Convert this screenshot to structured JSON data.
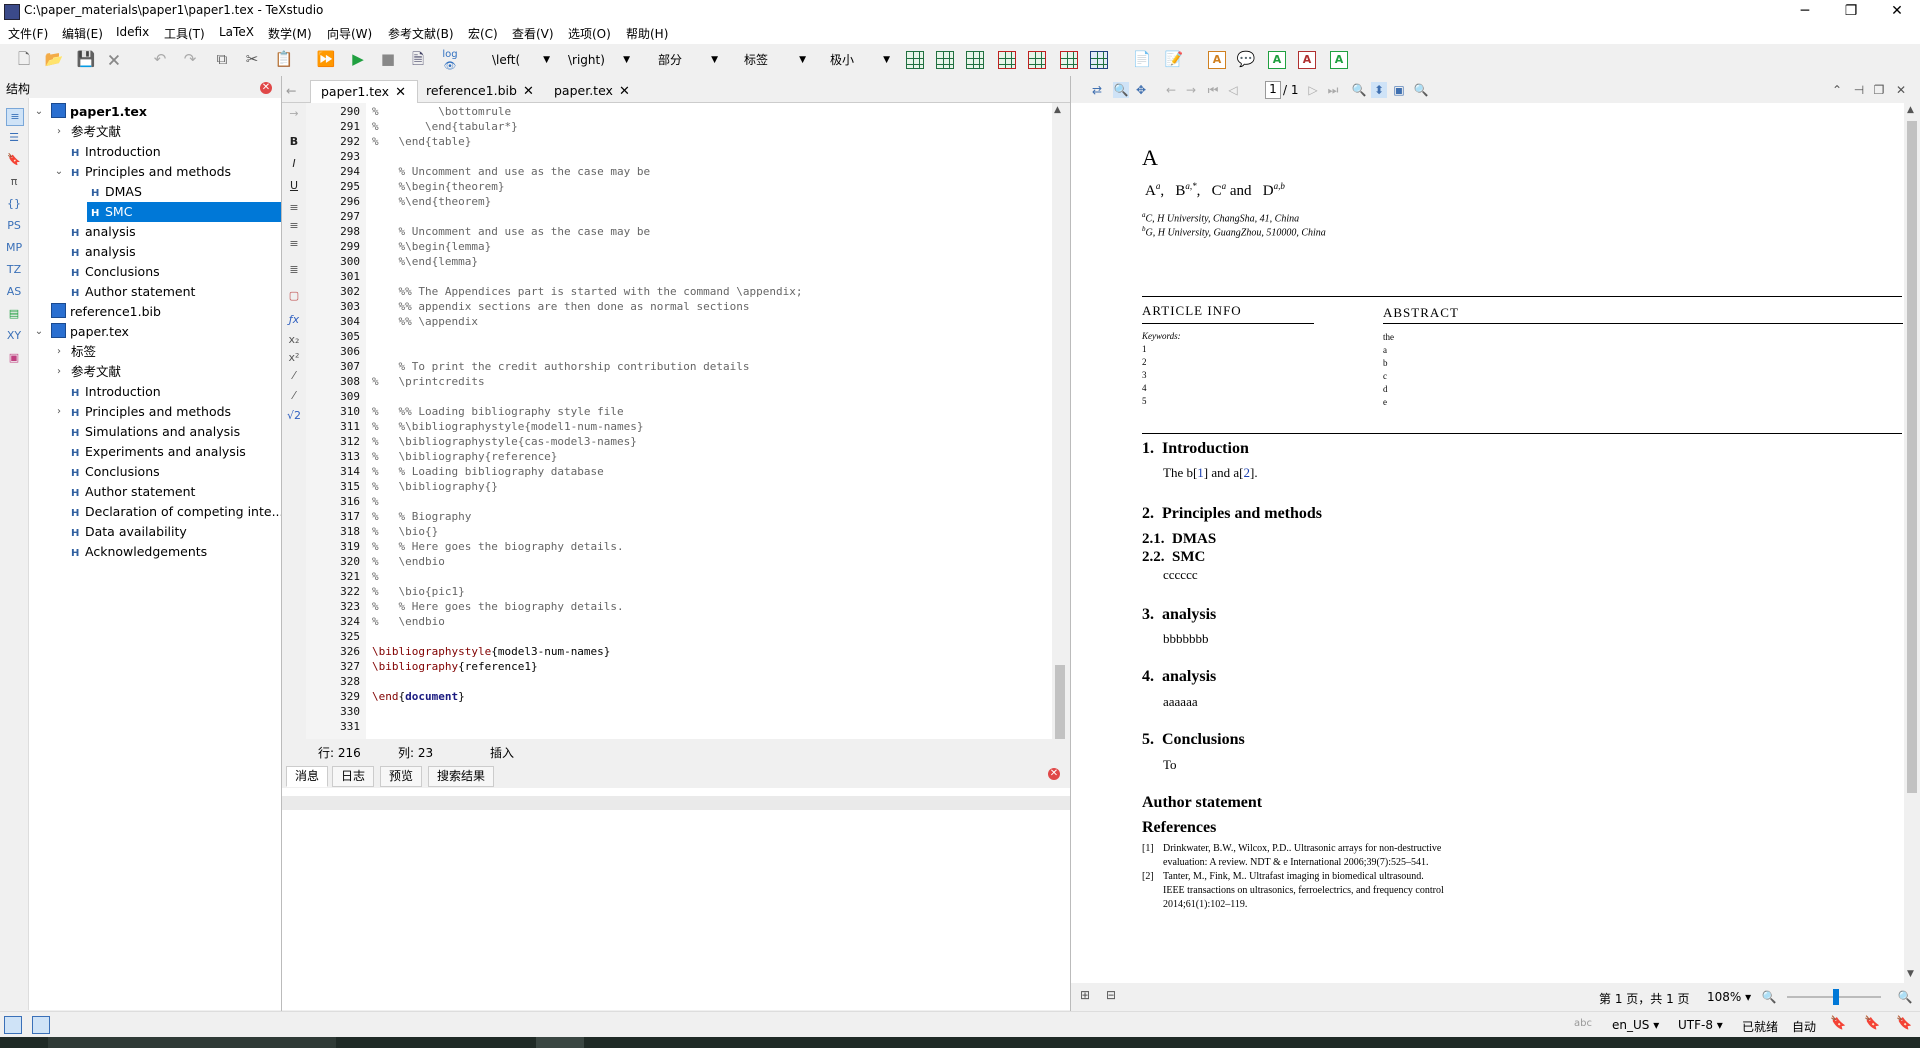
{
  "window": {
    "title": "C:\\paper_materials\\paper1\\paper1.tex - TeXstudio",
    "minimize": "─",
    "maximize": "❐",
    "close": "✕"
  },
  "menu": [
    "文件(F)",
    "编辑(E)",
    "Idefix",
    "工具(T)",
    "LaTeX",
    "数学(M)",
    "向导(W)",
    "参考文献(B)",
    "宏(C)",
    "查看(V)",
    "选项(O)",
    "帮助(H)"
  ],
  "toolbar": {
    "left_combo": "\\left(",
    "right_combo": "\\right)",
    "section_combo": "部分",
    "label_combo": "标签",
    "size_combo": "极小",
    "log_label": "log"
  },
  "structure": {
    "title": "结构",
    "items": [
      {
        "text": "paper1.tex",
        "kind": "file",
        "level": 0,
        "expanded": true,
        "bold": true
      },
      {
        "text": "参考文献",
        "kind": "group",
        "level": 1,
        "expanded": false
      },
      {
        "text": "Introduction",
        "kind": "h",
        "level": 1
      },
      {
        "text": "Principles and methods",
        "kind": "h",
        "level": 1,
        "expanded": true
      },
      {
        "text": "DMAS",
        "kind": "h",
        "level": 2
      },
      {
        "text": "SMC",
        "kind": "h",
        "level": 2,
        "selected": true
      },
      {
        "text": "analysis",
        "kind": "h",
        "level": 1
      },
      {
        "text": "analysis",
        "kind": "h",
        "level": 1
      },
      {
        "text": "Conclusions",
        "kind": "h",
        "level": 1
      },
      {
        "text": "Author statement",
        "kind": "h",
        "level": 1
      },
      {
        "text": "reference1.bib",
        "kind": "file",
        "level": 0
      },
      {
        "text": "paper.tex",
        "kind": "file",
        "level": 0,
        "expanded": true
      },
      {
        "text": "标签",
        "kind": "group",
        "level": 1,
        "expanded": false
      },
      {
        "text": "参考文献",
        "kind": "group",
        "level": 1,
        "expanded": false
      },
      {
        "text": "Introduction",
        "kind": "h",
        "level": 1
      },
      {
        "text": "Principles and methods",
        "kind": "h",
        "level": 1,
        "expanded": false
      },
      {
        "text": "Simulations and analysis",
        "kind": "h",
        "level": 1
      },
      {
        "text": "Experiments and analysis",
        "kind": "h",
        "level": 1
      },
      {
        "text": "Conclusions",
        "kind": "h",
        "level": 1
      },
      {
        "text": "Author statement",
        "kind": "h",
        "level": 1
      },
      {
        "text": "Declaration of competing inte...",
        "kind": "h",
        "level": 1
      },
      {
        "text": "Data availability",
        "kind": "h",
        "level": 1
      },
      {
        "text": "Acknowledgements",
        "kind": "h",
        "level": 1
      }
    ]
  },
  "left_strip_icons": [
    "PS",
    "MP",
    "TZ",
    "AS",
    "XY"
  ],
  "editor": {
    "tabs": [
      {
        "label": "paper1.tex",
        "active": true
      },
      {
        "label": "reference1.bib",
        "active": false
      },
      {
        "label": "paper.tex",
        "active": false
      }
    ],
    "lines": [
      {
        "n": "290",
        "text": "%         \\bottomrule"
      },
      {
        "n": "291",
        "text": "%       \\end{tabular*}"
      },
      {
        "n": "292",
        "text": "%   \\end{table}"
      },
      {
        "n": "293",
        "text": ""
      },
      {
        "n": "294",
        "text": "    % Uncomment and use as the case may be"
      },
      {
        "n": "295",
        "text": "    %\\begin{theorem}"
      },
      {
        "n": "296",
        "text": "    %\\end{theorem}"
      },
      {
        "n": "297",
        "text": ""
      },
      {
        "n": "298",
        "text": "    % Uncomment and use as the case may be"
      },
      {
        "n": "299",
        "text": "    %\\begin{lemma}"
      },
      {
        "n": "300",
        "text": "    %\\end{lemma}"
      },
      {
        "n": "301",
        "text": ""
      },
      {
        "n": "302",
        "text": "    %% The Appendices part is started with the command \\appendix;"
      },
      {
        "n": "303",
        "text": "    %% appendix sections are then done as normal sections"
      },
      {
        "n": "304",
        "text": "    %% \\appendix"
      },
      {
        "n": "305",
        "text": ""
      },
      {
        "n": "306",
        "text": ""
      },
      {
        "n": "307",
        "text": "    % To print the credit authorship contribution details"
      },
      {
        "n": "308",
        "text": "%   \\printcredits"
      },
      {
        "n": "309",
        "text": ""
      },
      {
        "n": "310",
        "text": "%   %% Loading bibliography style file"
      },
      {
        "n": "311",
        "text": "%   %\\bibliographystyle{model1-num-names}"
      },
      {
        "n": "312",
        "text": "%   \\bibliographystyle{cas-model3-names}"
      },
      {
        "n": "313",
        "text": "%   \\bibliography{reference}"
      },
      {
        "n": "314",
        "text": "%   % Loading bibliography database"
      },
      {
        "n": "315",
        "text": "%   \\bibliography{}"
      },
      {
        "n": "316",
        "text": "%"
      },
      {
        "n": "317",
        "text": "%   % Biography"
      },
      {
        "n": "318",
        "text": "%   \\bio{}"
      },
      {
        "n": "319",
        "text": "%   % Here goes the biography details."
      },
      {
        "n": "320",
        "text": "%   \\endbio"
      },
      {
        "n": "321",
        "text": "%"
      },
      {
        "n": "322",
        "text": "%   \\bio{pic1}"
      },
      {
        "n": "323",
        "text": "%   % Here goes the biography details."
      },
      {
        "n": "324",
        "text": "%   \\endbio"
      },
      {
        "n": "325",
        "text": ""
      },
      {
        "n": "326",
        "text": "\\bibliographystyle{model3-num-names}",
        "cmd": true
      },
      {
        "n": "327",
        "text": "\\bibliography{reference1}",
        "cmd": true
      },
      {
        "n": "328",
        "text": ""
      },
      {
        "n": "329",
        "text": "\\end{document}",
        "cmd": true
      },
      {
        "n": "330",
        "text": ""
      },
      {
        "n": "331",
        "text": ""
      }
    ],
    "status": {
      "row": "行:  216",
      "col": "列:  23",
      "mode": "插入"
    }
  },
  "messages": {
    "tabs": [
      "消息",
      "日志",
      "预览",
      "搜索结果"
    ]
  },
  "viewer": {
    "page_field": "1",
    "page_total": "/ 1",
    "page_status": "第 1 页，共 1 页",
    "zoom": "108%",
    "pdf": {
      "title": "A",
      "authors": [
        "A",
        "a",
        "B",
        "a,*",
        "C",
        "a",
        "D",
        "a,b"
      ],
      "affil_a": "C, H University, ChangSha, 41, China",
      "affil_b": "G, H University, GuangZhou, 510000, China",
      "article_info": "ARTICLE INFO",
      "abstract": "ABSTRACT",
      "keywords_label": "Keywords:",
      "keywords": [
        "1",
        "2",
        "3",
        "4",
        "5"
      ],
      "abstract_lines": [
        "the",
        "a",
        "b",
        "c",
        "d",
        "e"
      ],
      "s1_num": "1.",
      "s1": "Introduction",
      "s1_text_pre": "The b[",
      "cite1": "1",
      "s1_text_mid": "] and a[",
      "cite2": "2",
      "s1_text_post": "].",
      "s2_num": "2.",
      "s2": "Principles and methods",
      "s21_num": "2.1.",
      "s21": "DMAS",
      "s22_num": "2.2.",
      "s22": "SMC",
      "s22_text": "cccccc",
      "s3_num": "3.",
      "s3": "analysis",
      "s3_text": "bbbbbbb",
      "s4_num": "4.",
      "s4": "analysis",
      "s4_text": "aaaaaa",
      "s5_num": "5.",
      "s5": "Conclusions",
      "s5_text": "To",
      "author_statement": "Author statement",
      "references": "References",
      "ref1_num": "[1]",
      "ref1_l1": "Drinkwater,  B.W., Wilcox,  P.D..  Ultrasonic arrays for non-destructive",
      "ref1_l2": "evaluation: A review.  NDT & e International 2006;39(7):525–541.",
      "ref2_num": "[2]",
      "ref2_l1": "Tanter,   M.,  Fink,   M..   Ultrafast imaging in biomedical ultrasound.",
      "ref2_l2": "IEEE transactions on ultrasonics, ferroelectrics, and frequency control",
      "ref2_l3": "2014;61(1):102–119."
    }
  },
  "statusbar": {
    "lang": "en_US",
    "encoding": "UTF-8",
    "ready": "已就绪",
    "auto": "自动"
  },
  "colors": {
    "accent": "#0078d7",
    "latex_cmd": "#800000",
    "link": "#1a3fb0"
  }
}
